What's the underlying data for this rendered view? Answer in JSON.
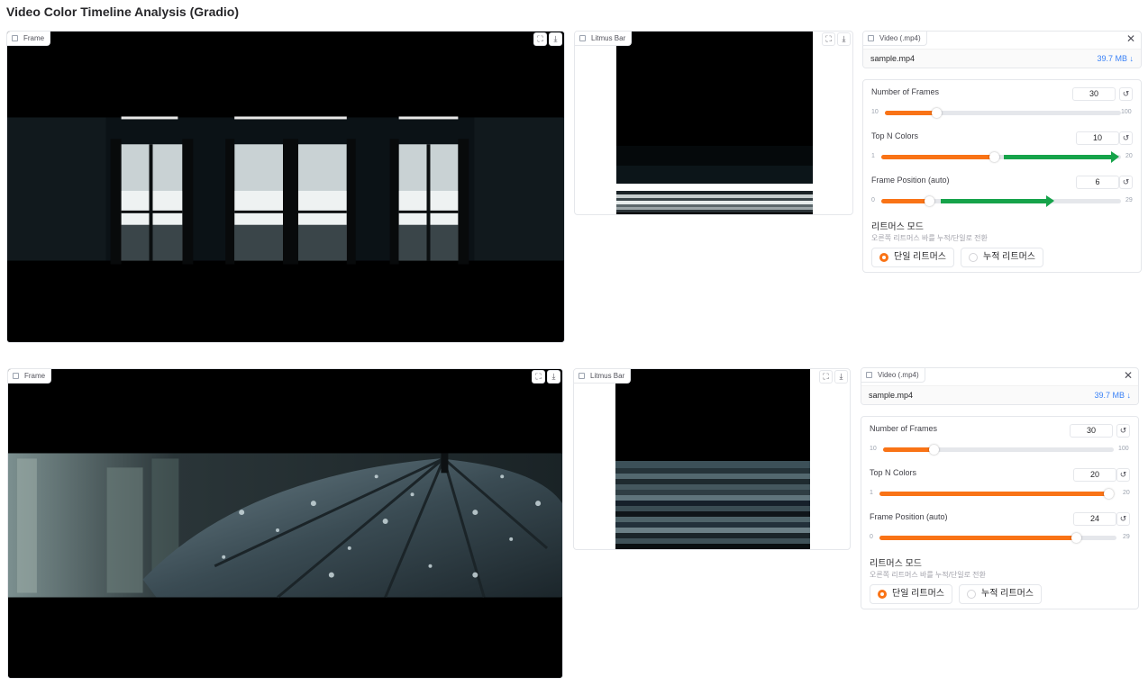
{
  "page_title": "Video Color Timeline Analysis (Gradio)",
  "panels": [
    {
      "frame_label": "Frame",
      "litmus_label": "Litmus Bar",
      "video_label": "Video (.mp4)",
      "file_name": "sample.mp4",
      "file_size": "39.7 MB ↓",
      "frames": {
        "label": "Number of Frames",
        "value": "30",
        "min": "10",
        "max": "100",
        "level": 0.22
      },
      "colors": {
        "label": "Top N Colors",
        "value": "10",
        "min": "1",
        "max": "20",
        "level": 0.47
      },
      "position": {
        "label": "Frame Position (auto)",
        "value": "6",
        "min": "0",
        "max": "29",
        "level": 0.2
      },
      "mode": {
        "title": "리트머스 모드",
        "subtitle": "오른쪽 리트머스 바를 누적/단일로 전환",
        "option_single": "단일 리트머스",
        "option_cumulative": "누적 리트머스",
        "selected": "single"
      }
    },
    {
      "frame_label": "Frame",
      "litmus_label": "Litmus Bar",
      "video_label": "Video (.mp4)",
      "file_name": "sample.mp4",
      "file_size": "39.7 MB ↓",
      "frames": {
        "label": "Number of Frames",
        "value": "30",
        "min": "10",
        "max": "100",
        "level": 0.22
      },
      "colors": {
        "label": "Top N Colors",
        "value": "20",
        "min": "1",
        "max": "20",
        "level": 1.0
      },
      "position": {
        "label": "Frame Position (auto)",
        "value": "24",
        "min": "0",
        "max": "29",
        "level": 0.83
      },
      "mode": {
        "title": "리트머스 모드",
        "subtitle": "오른쪽 리트머스 바를 누적/단일로 전환",
        "option_single": "단일 리트머스",
        "option_cumulative": "누적 리트머스",
        "selected": "single"
      }
    }
  ],
  "icons": {
    "fullscreen": "fullscreen-icon",
    "download": "download-icon",
    "reset": "reset-icon",
    "close": "close-icon",
    "file": "file-icon",
    "image": "image-icon"
  },
  "colors": {
    "accent": "#f97316",
    "annotation_arrow": "#16a34a",
    "link": "#3b82f6"
  }
}
